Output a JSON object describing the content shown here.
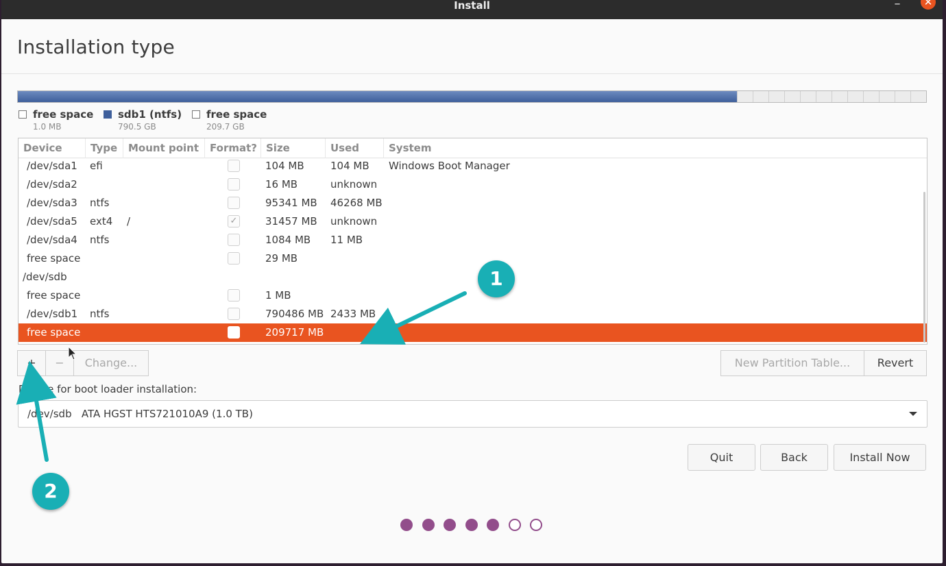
{
  "window": {
    "title": "Install",
    "minimize_glyph": "–",
    "close_glyph": "✕"
  },
  "page": {
    "heading": "Installation type"
  },
  "disk": {
    "legend": [
      {
        "name": "free space",
        "size": "1.0 MB",
        "swatch": "empty"
      },
      {
        "name": "sdb1 (ntfs)",
        "size": "790.5 GB",
        "swatch": "blue"
      },
      {
        "name": "free space",
        "size": "209.7 GB",
        "swatch": "empty"
      }
    ],
    "used_color": "#3e5f9b"
  },
  "table": {
    "columns": [
      "Device",
      "Type",
      "Mount point",
      "Format?",
      "Size",
      "Used",
      "System"
    ],
    "rows": [
      {
        "device": "/dev/sda1",
        "type": "efi",
        "mount": "",
        "format": false,
        "size": "104 MB",
        "used": "104 MB",
        "system": "Windows Boot Manager"
      },
      {
        "device": "/dev/sda2",
        "type": "",
        "mount": "",
        "format": false,
        "size": "16 MB",
        "used": "unknown",
        "system": ""
      },
      {
        "device": "/dev/sda3",
        "type": "ntfs",
        "mount": "",
        "format": false,
        "size": "95341 MB",
        "used": "46268 MB",
        "system": ""
      },
      {
        "device": "/dev/sda5",
        "type": "ext4",
        "mount": "/",
        "format": true,
        "size": "31457 MB",
        "used": "unknown",
        "system": ""
      },
      {
        "device": "/dev/sda4",
        "type": "ntfs",
        "mount": "",
        "format": false,
        "size": "1084 MB",
        "used": "11 MB",
        "system": ""
      },
      {
        "device": "free space",
        "type": "",
        "mount": "",
        "format": false,
        "size": "29 MB",
        "used": "",
        "system": ""
      },
      {
        "device": "/dev/sdb",
        "type": "",
        "mount": "",
        "format": null,
        "size": "",
        "used": "",
        "system": ""
      },
      {
        "device": "free space",
        "type": "",
        "mount": "",
        "format": false,
        "size": "1 MB",
        "used": "",
        "system": ""
      },
      {
        "device": "/dev/sdb1",
        "type": "ntfs",
        "mount": "",
        "format": false,
        "size": "790486 MB",
        "used": "2433 MB",
        "system": ""
      },
      {
        "device": "free space",
        "type": "",
        "mount": "",
        "format": false,
        "size": "209717 MB",
        "used": "",
        "system": "",
        "selected": true
      }
    ],
    "selected_color": "#e95420"
  },
  "toolbar": {
    "add_label": "+",
    "remove_label": "−",
    "change_label": "Change...",
    "new_table_label": "New Partition Table...",
    "revert_label": "Revert"
  },
  "bootloader": {
    "label": "Device for boot loader installation:",
    "value": "/dev/sdb   ATA HGST HTS721010A9 (1.0 TB)"
  },
  "actions": {
    "quit_label": "Quit",
    "back_label": "Back",
    "install_label": "Install Now"
  },
  "progress": {
    "current_step": 5,
    "total_steps": 7,
    "accent": "#924d8b"
  },
  "annotations": {
    "badge_1": "1",
    "badge_2": "2",
    "color": "#19afb5"
  }
}
